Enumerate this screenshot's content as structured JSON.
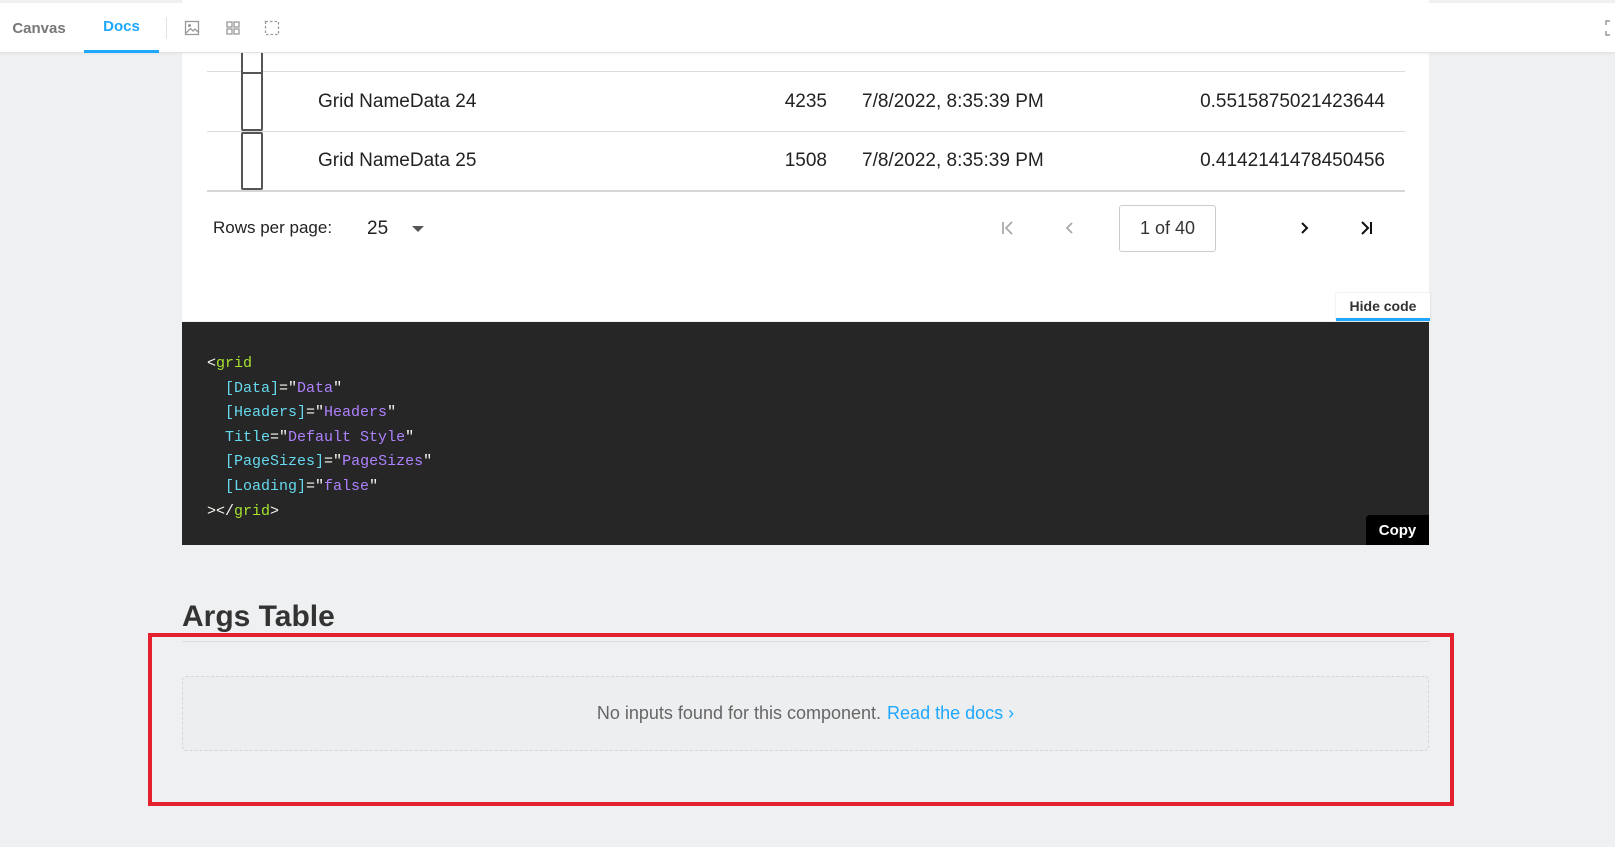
{
  "toolbar": {
    "tabs": [
      {
        "label": "Canvas",
        "active": false
      },
      {
        "label": "Docs",
        "active": true
      }
    ],
    "icons": [
      "image-icon",
      "grid-icon",
      "outline-icon",
      "fullscreen-icon"
    ],
    "accent": "#1ea7fd"
  },
  "table": {
    "rows": [
      {
        "name": "Grid NameData 24",
        "number": "4235",
        "date": "7/8/2022, 8:35:39 PM",
        "value": "0.5515875021423644"
      },
      {
        "name": "Grid NameData 25",
        "number": "1508",
        "date": "7/8/2022, 8:35:39 PM",
        "value": "0.4142141478450456"
      }
    ]
  },
  "pager": {
    "rows_per_page_label": "Rows per page:",
    "rows_per_page_value": "25",
    "page_indicator": "1 of 40"
  },
  "code_panel": {
    "hide_code_label": "Hide code",
    "copy_label": "Copy",
    "lines": [
      {
        "tag_open": "<",
        "tag": "grid"
      },
      {
        "attr": "[Data]",
        "value": "Data"
      },
      {
        "attr": "[Headers]",
        "value": "Headers"
      },
      {
        "attr": "Title",
        "value": "Default Style"
      },
      {
        "attr": "[PageSizes]",
        "value": "PageSizes"
      },
      {
        "attr": "[Loading]",
        "value": "false"
      },
      {
        "tag_close": "></",
        "tag": "grid",
        "end": ">"
      }
    ]
  },
  "args_table": {
    "title": "Args Table",
    "empty_text": "No inputs found for this component.",
    "link_text": "Read the docs ›"
  },
  "highlight_color": "#e4202d"
}
